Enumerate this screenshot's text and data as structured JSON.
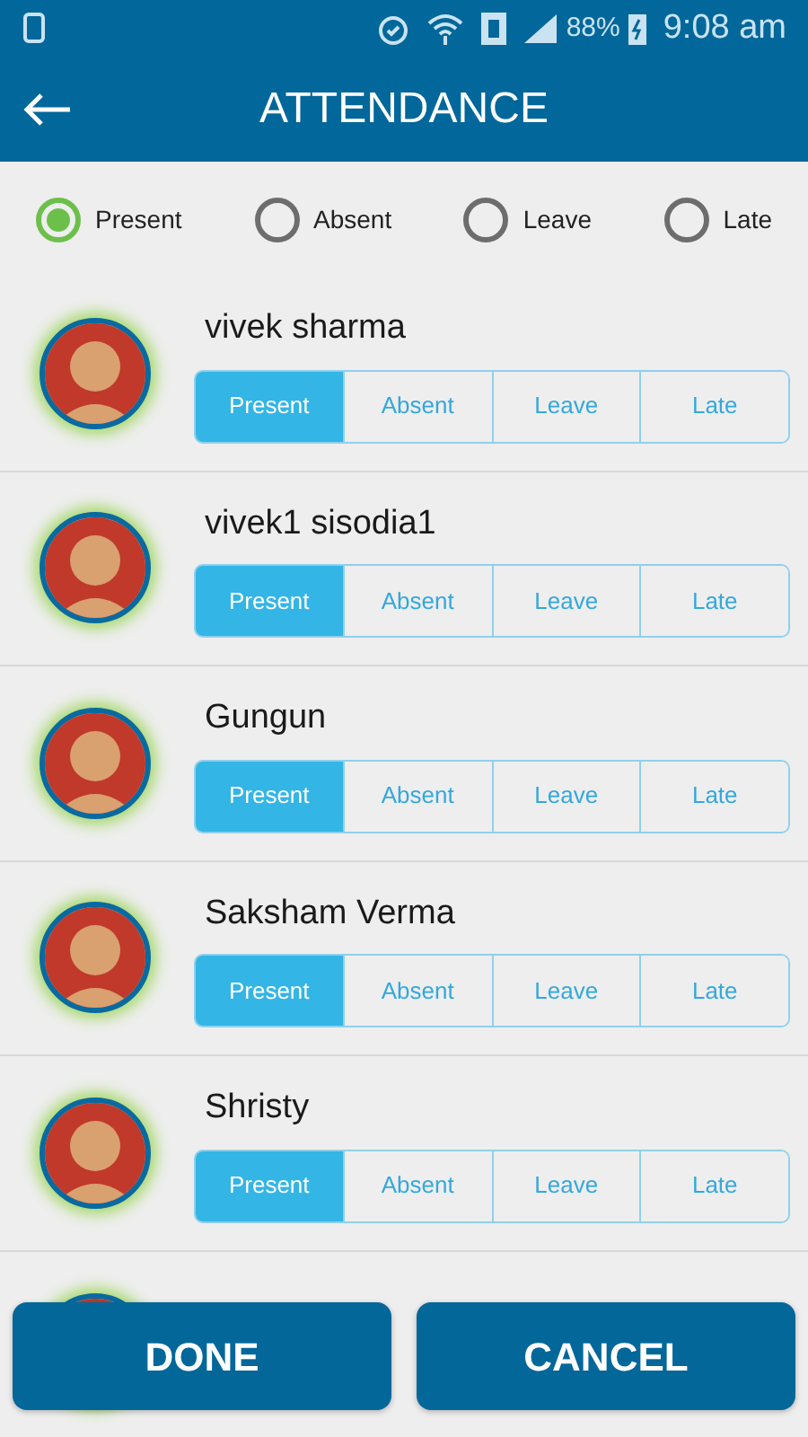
{
  "status_bar": {
    "battery": "88%",
    "time": "9:08 am"
  },
  "header": {
    "title": "ATTENDANCE"
  },
  "mark_all": [
    {
      "label": "Present",
      "selected": true
    },
    {
      "label": "Absent",
      "selected": false
    },
    {
      "label": "Leave",
      "selected": false
    },
    {
      "label": "Late",
      "selected": false
    }
  ],
  "students": [
    {
      "name": "vivek sharma",
      "options": [
        {
          "label": "Present",
          "selected": true
        },
        {
          "label": "Absent",
          "selected": false
        },
        {
          "label": "Leave",
          "selected": false
        },
        {
          "label": "Late",
          "selected": false
        }
      ]
    },
    {
      "name": "vivek1 sisodia1",
      "options": [
        {
          "label": "Present",
          "selected": true
        },
        {
          "label": "Absent",
          "selected": false
        },
        {
          "label": "Leave",
          "selected": false
        },
        {
          "label": "Late",
          "selected": false
        }
      ]
    },
    {
      "name": "Gungun",
      "options": [
        {
          "label": "Present",
          "selected": true
        },
        {
          "label": "Absent",
          "selected": false
        },
        {
          "label": "Leave",
          "selected": false
        },
        {
          "label": "Late",
          "selected": false
        }
      ]
    },
    {
      "name": "Saksham Verma",
      "options": [
        {
          "label": "Present",
          "selected": true
        },
        {
          "label": "Absent",
          "selected": false
        },
        {
          "label": "Leave",
          "selected": false
        },
        {
          "label": "Late",
          "selected": false
        }
      ]
    },
    {
      "name": "Shristy",
      "options": [
        {
          "label": "Present",
          "selected": true
        },
        {
          "label": "Absent",
          "selected": false
        },
        {
          "label": "Leave",
          "selected": false
        },
        {
          "label": "Late",
          "selected": false
        }
      ]
    }
  ],
  "buttons": [
    "DONE",
    "CANCEL"
  ]
}
